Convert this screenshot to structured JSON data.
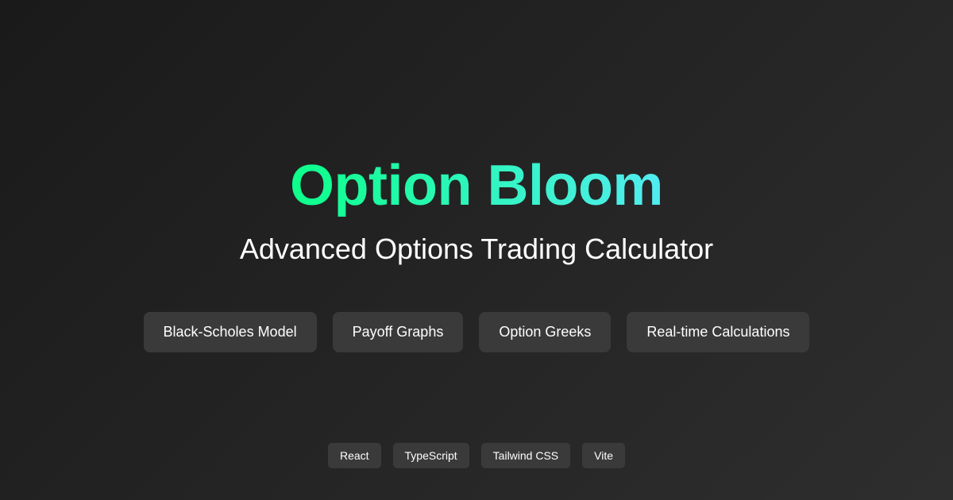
{
  "title": "Option Bloom",
  "subtitle": "Advanced Options Trading Calculator",
  "features": [
    "Black-Scholes Model",
    "Payoff Graphs",
    "Option Greeks",
    "Real-time Calculations"
  ],
  "tech_stack": [
    "React",
    "TypeScript",
    "Tailwind CSS",
    "Vite"
  ],
  "colors": {
    "background_start": "#1a1a1a",
    "background_end": "#2e2e2e",
    "title_gradient_start": "#0dff8a",
    "title_gradient_end": "#52ecf0",
    "pill_background": "#3a3a3a",
    "text": "#ffffff"
  }
}
